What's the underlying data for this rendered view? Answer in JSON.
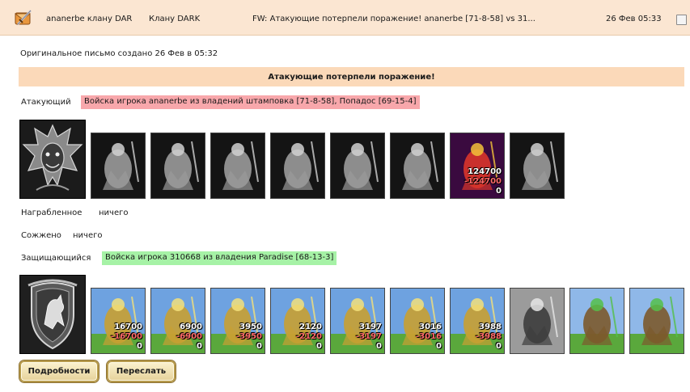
{
  "header": {
    "from": "ananerbe клану DAR",
    "to": "Клану DARK",
    "subject": "FW: Атакующие потерпели поражение! ananerbe [71-8-58] vs 31...",
    "date": "26 Фев 05:33",
    "icon": "mail-sword-icon"
  },
  "original_note": "Оригинальное письмо создано 26 Фев в 05:32",
  "result_banner": "Атакующие потерпели поражение!",
  "attacker": {
    "label": "Атакующий",
    "description": "Войска игрока ananerbe из владений штамповка [71-8-58], Попадос [69-15-4]",
    "hero_icon": "dragon-crest-icon",
    "units": [
      {
        "icon": "ghost-dragon-icon",
        "count": "",
        "loss": "",
        "survivors": ""
      },
      {
        "icon": "skeleton-warrior-icon",
        "count": "",
        "loss": "",
        "survivors": ""
      },
      {
        "icon": "ghoul-icon",
        "count": "",
        "loss": "",
        "survivors": ""
      },
      {
        "icon": "bone-dragon-icon",
        "count": "",
        "loss": "",
        "survivors": ""
      },
      {
        "icon": "shadow-beast-icon",
        "count": "",
        "loss": "",
        "survivors": ""
      },
      {
        "icon": "death-knight-icon",
        "count": "",
        "loss": "",
        "survivors": ""
      },
      {
        "icon": "pit-lord-icon",
        "count": "124700",
        "loss": "-124700",
        "survivors": "0"
      },
      {
        "icon": "wraith-icon",
        "count": "",
        "loss": "",
        "survivors": ""
      }
    ]
  },
  "plundered": {
    "label": "Награбленное",
    "value": "ничего"
  },
  "burned": {
    "label": "Сожжено",
    "value": "ничего"
  },
  "defender": {
    "label": "Защищающийся",
    "description": "Войска игрока 310668 из владения Paradise [68-13-3]",
    "hero_icon": "griffin-shield-icon",
    "units": [
      {
        "icon": "ballista-cart-icon",
        "count": "16700",
        "loss": "-16700",
        "survivors": "0"
      },
      {
        "icon": "griffin-rider-icon",
        "count": "6900",
        "loss": "-6900",
        "survivors": "0"
      },
      {
        "icon": "knight-rider-icon",
        "count": "3950",
        "loss": "-3950",
        "survivors": "0"
      },
      {
        "icon": "golden-horse-icon",
        "count": "2120",
        "loss": "-2120",
        "survivors": "0"
      },
      {
        "icon": "crossbowman-icon",
        "count": "3197",
        "loss": "-3197",
        "survivors": "0"
      },
      {
        "icon": "green-monk-icon",
        "count": "3016",
        "loss": "-3016",
        "survivors": "0"
      },
      {
        "icon": "swordsman-icon",
        "count": "3988",
        "loss": "-3988",
        "survivors": "0"
      },
      {
        "icon": "grey-wraith-icon",
        "count": "",
        "loss": "",
        "survivors": ""
      },
      {
        "icon": "tower-icon",
        "count": "",
        "loss": "",
        "survivors": ""
      },
      {
        "icon": "tower-icon",
        "count": "",
        "loss": "",
        "survivors": ""
      }
    ]
  },
  "buttons": {
    "details": "Подробности",
    "forward": "Переслать"
  },
  "colors": {
    "header_bg": "#fbe6d2",
    "banner_bg": "#fbd9b9",
    "attacker_chip": "#f8a7ab",
    "defender_chip": "#a6f2a6",
    "loss_text": "#ff6a6a"
  }
}
